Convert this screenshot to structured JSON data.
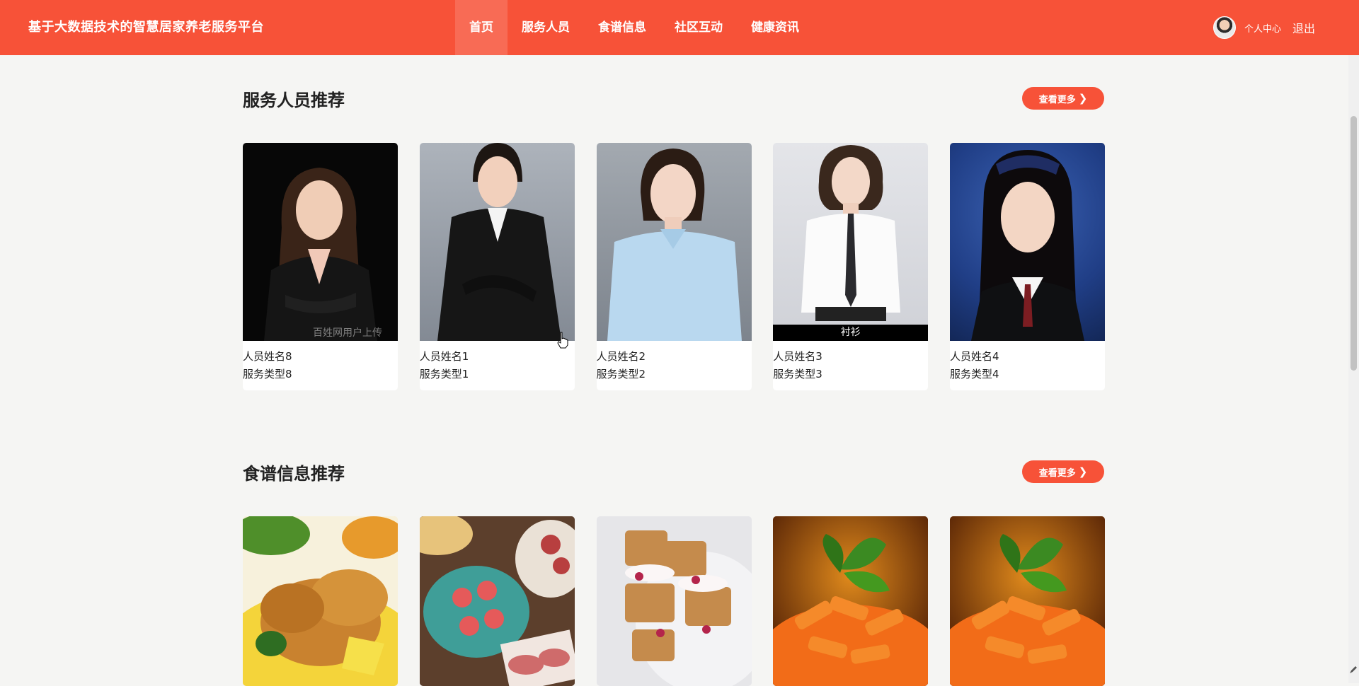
{
  "header": {
    "site_title": "基于大数据技术的智慧居家养老服务平台",
    "nav": [
      {
        "label": "首页",
        "active": true
      },
      {
        "label": "服务人员",
        "active": false
      },
      {
        "label": "食谱信息",
        "active": false
      },
      {
        "label": "社区互动",
        "active": false
      },
      {
        "label": "健康资讯",
        "active": false
      }
    ],
    "user_center": "个人中心",
    "logout": "退出"
  },
  "staff_section": {
    "title": "服务人员推荐",
    "more": "查看更多",
    "cards": [
      {
        "name": "人员姓名8",
        "type": "服务类型8",
        "watermark": "百姓网用户上传"
      },
      {
        "name": "人员姓名1",
        "type": "服务类型1"
      },
      {
        "name": "人员姓名2",
        "type": "服务类型2"
      },
      {
        "name": "人员姓名3",
        "type": "服务类型3",
        "caption": "衬衫"
      },
      {
        "name": "人员姓名4",
        "type": "服务类型4"
      }
    ]
  },
  "recipe_section": {
    "title": "食谱信息推荐",
    "more": "查看更多",
    "cards": [
      {
        "image_icon": "fried-chicken-image"
      },
      {
        "image_icon": "cold-cuts-platter-image"
      },
      {
        "image_icon": "waffle-dessert-image"
      },
      {
        "image_icon": "penne-pasta-image"
      },
      {
        "image_icon": "penne-pasta-image"
      }
    ]
  },
  "colors": {
    "brand": "#f75238",
    "nav_active": "#f86b55",
    "page_bg": "#f5f5f3"
  }
}
